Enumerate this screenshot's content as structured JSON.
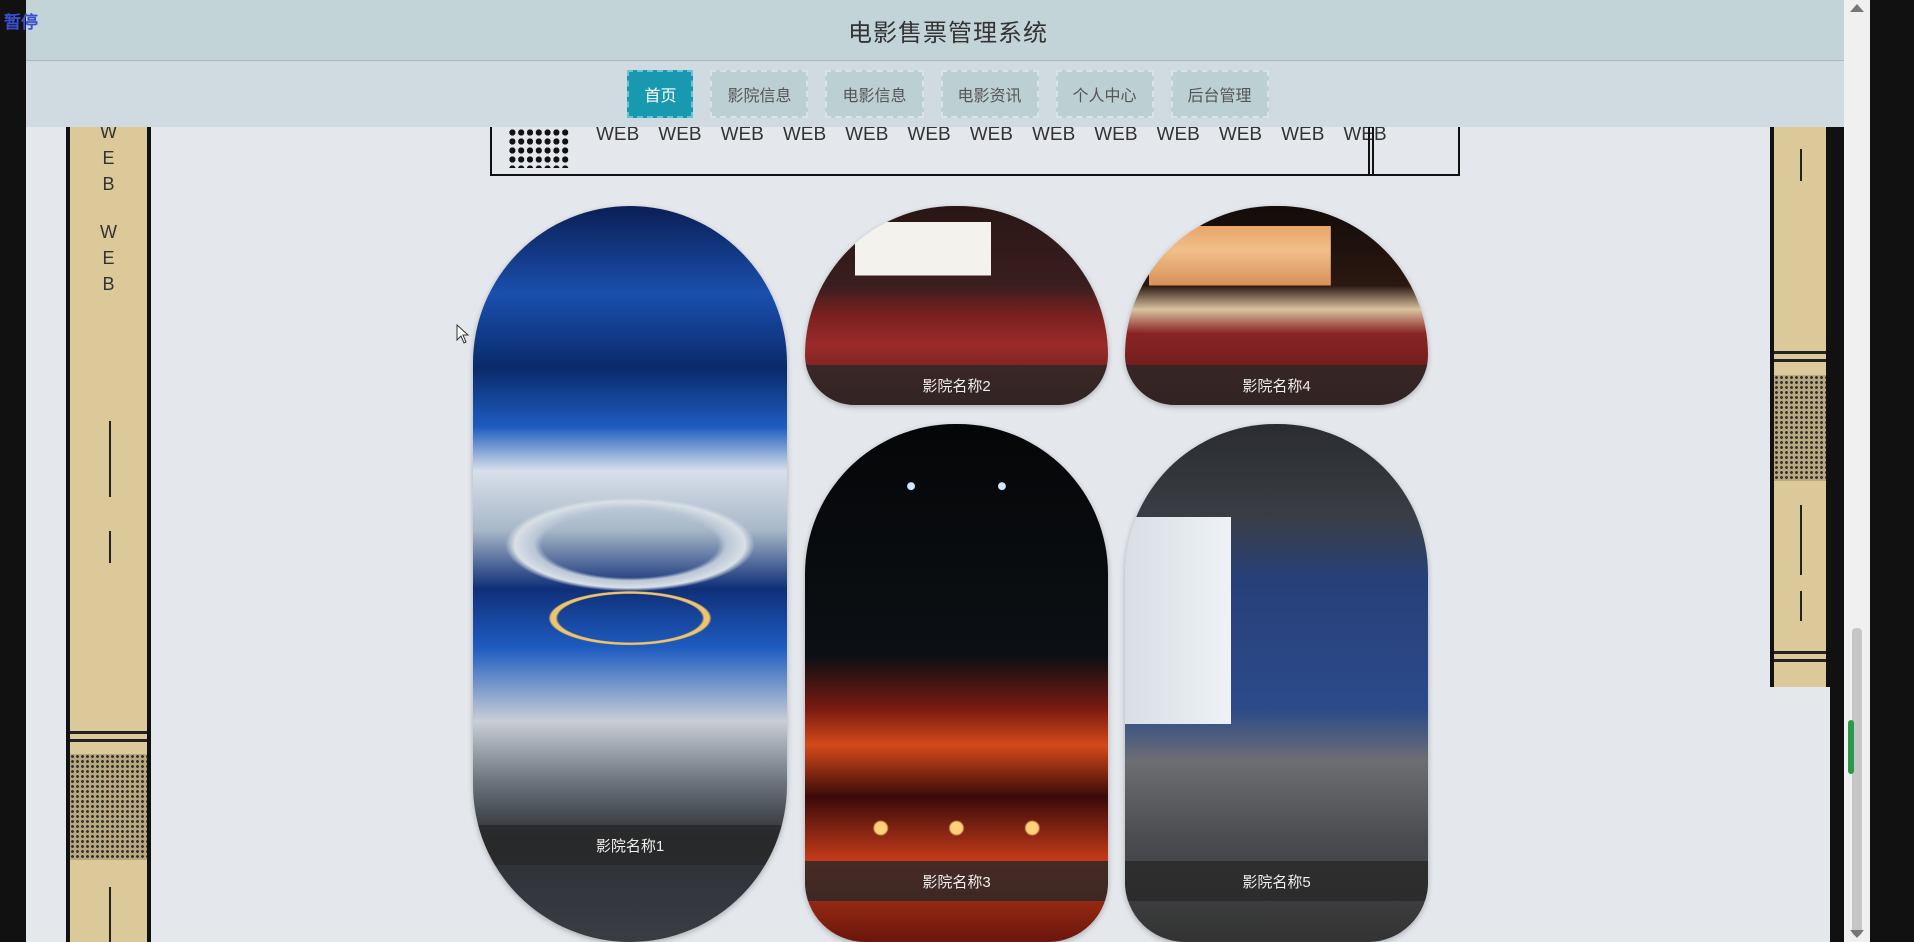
{
  "overlay": {
    "pause_label": "暂停"
  },
  "header": {
    "title": "电影售票管理系统"
  },
  "nav": {
    "items": [
      {
        "label": "首页",
        "active": true
      },
      {
        "label": "影院信息",
        "active": false
      },
      {
        "label": "电影信息",
        "active": false
      },
      {
        "label": "电影资讯",
        "active": false
      },
      {
        "label": "个人中心",
        "active": false
      },
      {
        "label": "后台管理",
        "active": false
      }
    ]
  },
  "left_deco": {
    "letters": [
      "W",
      "E",
      "B",
      "",
      "W",
      "E",
      "B"
    ]
  },
  "ticker": {
    "words": [
      "WEB",
      "WEB",
      "WEB",
      "WEB",
      "WEB",
      "WEB",
      "WEB",
      "WEB",
      "WEB",
      "WEB",
      "WEB",
      "WEB",
      "WEB"
    ]
  },
  "cinemas": [
    {
      "name": "影院名称1"
    },
    {
      "name": "影院名称2"
    },
    {
      "name": "影院名称3"
    },
    {
      "name": "影院名称4"
    },
    {
      "name": "影院名称5"
    }
  ],
  "colors": {
    "accent": "#1999b0",
    "header_bg": "#c3d4d9",
    "nav_bg": "#cfdbe0",
    "deco_tan": "#dcc99a"
  }
}
